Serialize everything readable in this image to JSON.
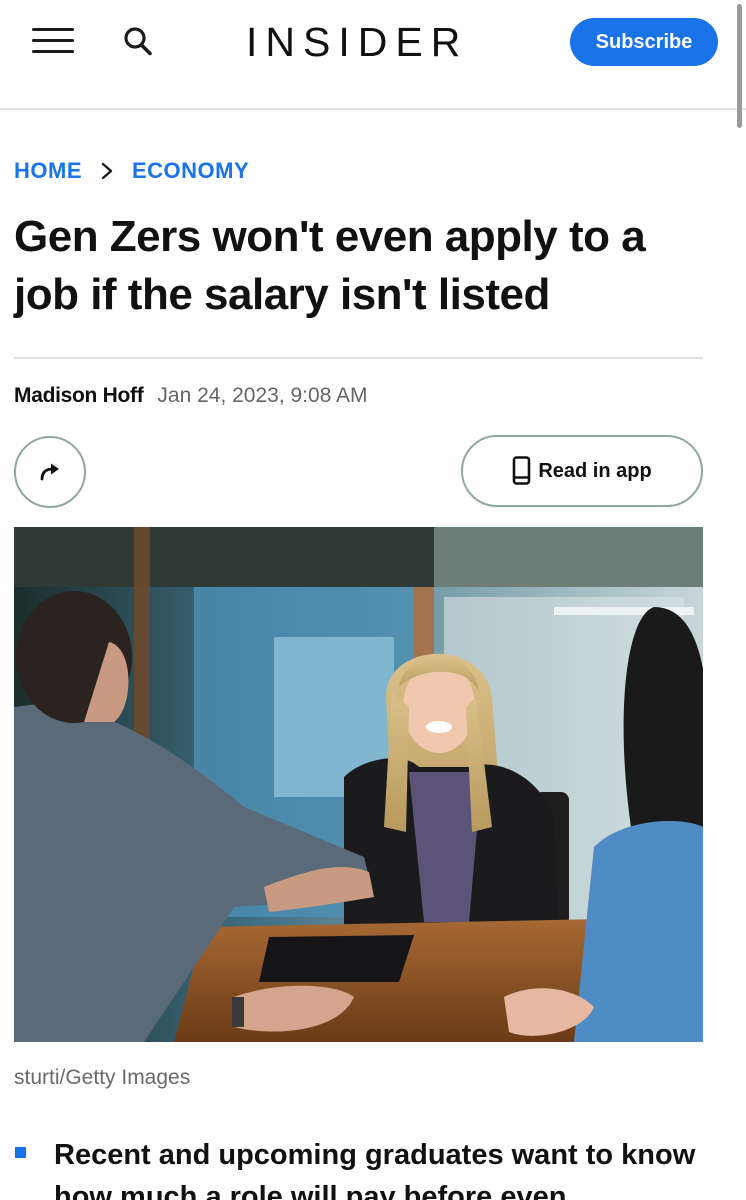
{
  "header": {
    "brand": "INSIDER",
    "subscribe_label": "Subscribe",
    "accent_color": "#1a73e8"
  },
  "breadcrumb": {
    "items": [
      "HOME",
      "ECONOMY"
    ]
  },
  "article": {
    "headline": "Gen Zers won't even apply to a job if the salary isn't listed",
    "author": "Madison Hoff",
    "date": "Jan 24, 2023, 9:08 AM",
    "read_in_app_label": "Read in app",
    "photo_caption": "sturti/Getty Images",
    "bullets": [
      "Recent and upcoming graduates want to know how much a role will pay before even"
    ]
  },
  "icons": {
    "menu": "hamburger-menu-icon",
    "search": "search-icon",
    "share": "share-arrow-icon",
    "phone": "phone-icon",
    "chevron": "chevron-right-icon"
  }
}
